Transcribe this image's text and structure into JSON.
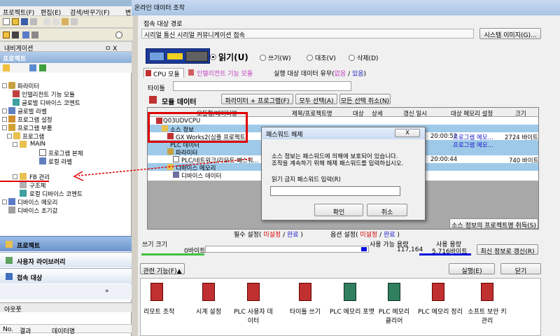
{
  "titlebar": {
    "text": "온라인 데이터 조작"
  },
  "menubar": {
    "items": [
      "프로젝트(F)",
      "편집(E)",
      "검색/바꾸기(F)",
      "변"
    ]
  },
  "nav": {
    "title": "내비게이션",
    "pin": "ㅁ X",
    "section": "프로젝트",
    "tree": [
      "파라미터",
      "인텔리전트 기능 모듈",
      "글로벌 디바이스 코멘트",
      "글로벌 라벨",
      "프로그램 설정",
      "프로그램 부품",
      "프로그램",
      "MAIN",
      "프로그램 본체",
      "로컬 라벨",
      "FB 관리",
      "구조체",
      "로컬 디바이스 코멘트",
      "디바이스 메모리",
      "디바이스 초기값"
    ],
    "bottom_tabs": [
      "프로젝트",
      "사용자 라이브러리",
      "접속 대상"
    ],
    "output_title": "아웃풋",
    "output_cols": [
      "No.",
      "결과",
      "데이터명"
    ]
  },
  "dialog": {
    "connect_label": "접속 대상 경로",
    "connect_path": "시리얼 통신 시리얼 커뮤니케이션 접속",
    "system_image_btn": "시스템 이미지(G)...",
    "modes": [
      "읽기(U)",
      "쓰기(W)",
      "대조(V)",
      "삭제(D)"
    ],
    "tabs": [
      "CPU 모듈",
      "인텔리전트 기능 모듈"
    ],
    "exec_label": "실행 대상 데이터 유무(",
    "exec_yes": "없음",
    "exec_sep": "/",
    "exec_no": "있음",
    "exec_end": ")",
    "title_label": "타이틀",
    "module_data": "모듈 데이터",
    "btn_param_prog": "파라미터 + 프로그램(F)",
    "btn_select_all": "모두 선택(A)",
    "btn_deselect_all": "모든 선택 취소(N)",
    "columns": [
      "모듈형/데이터명",
      "제목/프로젝트명",
      "대상",
      "상세",
      "갱신 일시",
      "대상 메모리 설정",
      "크기"
    ],
    "rows": [
      {
        "name": "Q03UDVCPU"
      },
      {
        "name": "소스 정보"
      },
      {
        "name": "GX Works2(심플 프로젝트)",
        "time": "20:00:52",
        "mem": "프로그램 메모...",
        "size": "2724 바이트"
      },
      {
        "name": "PLC 데이터",
        "mem": "프로그램 메모..."
      },
      {
        "name": "파라미터"
      },
      {
        "name": "PLC/네트워크/리모트 패스워...",
        "time": "20:00:44",
        "size": "740 바이트"
      },
      {
        "name": "디바이스 메모리"
      },
      {
        "name": "디바이스 데이터"
      }
    ],
    "src_info_btn": "소스 정보의 프로젝트명 취득(S)",
    "required_label": "필수 설정(",
    "optional_label": "옵션 설정(",
    "unset": "미설정",
    "done": "완료",
    "write_size": "쓰기 크기",
    "zero_bytes": "0바이트",
    "usable_label": "사용 가능 용량",
    "usable_value": "117,164",
    "used_label": "사용 용량",
    "used_value": "5,716바이트",
    "refresh_btn": "최신 정보로 갱신(R)",
    "related_btn": "관련 기능(F)▲",
    "execute_btn": "실행(E)",
    "close_btn": "닫기",
    "functions": [
      "리모트 조작",
      "시계 설정",
      "PLC 사용자 데이터",
      "타이틀 쓰기",
      "PLC 메모리 포맷",
      "PLC 메모리 클리어",
      "PLC 메모리 정리",
      "소프트 보안 키 관리"
    ]
  },
  "password": {
    "title": "패스워드 해제",
    "close": "X",
    "message1": "소스 정보는 패스워드에 의해에 보호되어 있습니다.",
    "message2": "조작을 계속하기 위해 해제 패스워드를 입력하십시오.",
    "input_label": "읽기 금지 패스워드 입력(R)",
    "input_value": "",
    "ok": "확인",
    "cancel": "취소"
  },
  "colors": {
    "highlight": "#9fc9e8",
    "annotation": "#e00000",
    "link": "#1a1acc",
    "required": "#d60000",
    "done": "#2222cc"
  }
}
